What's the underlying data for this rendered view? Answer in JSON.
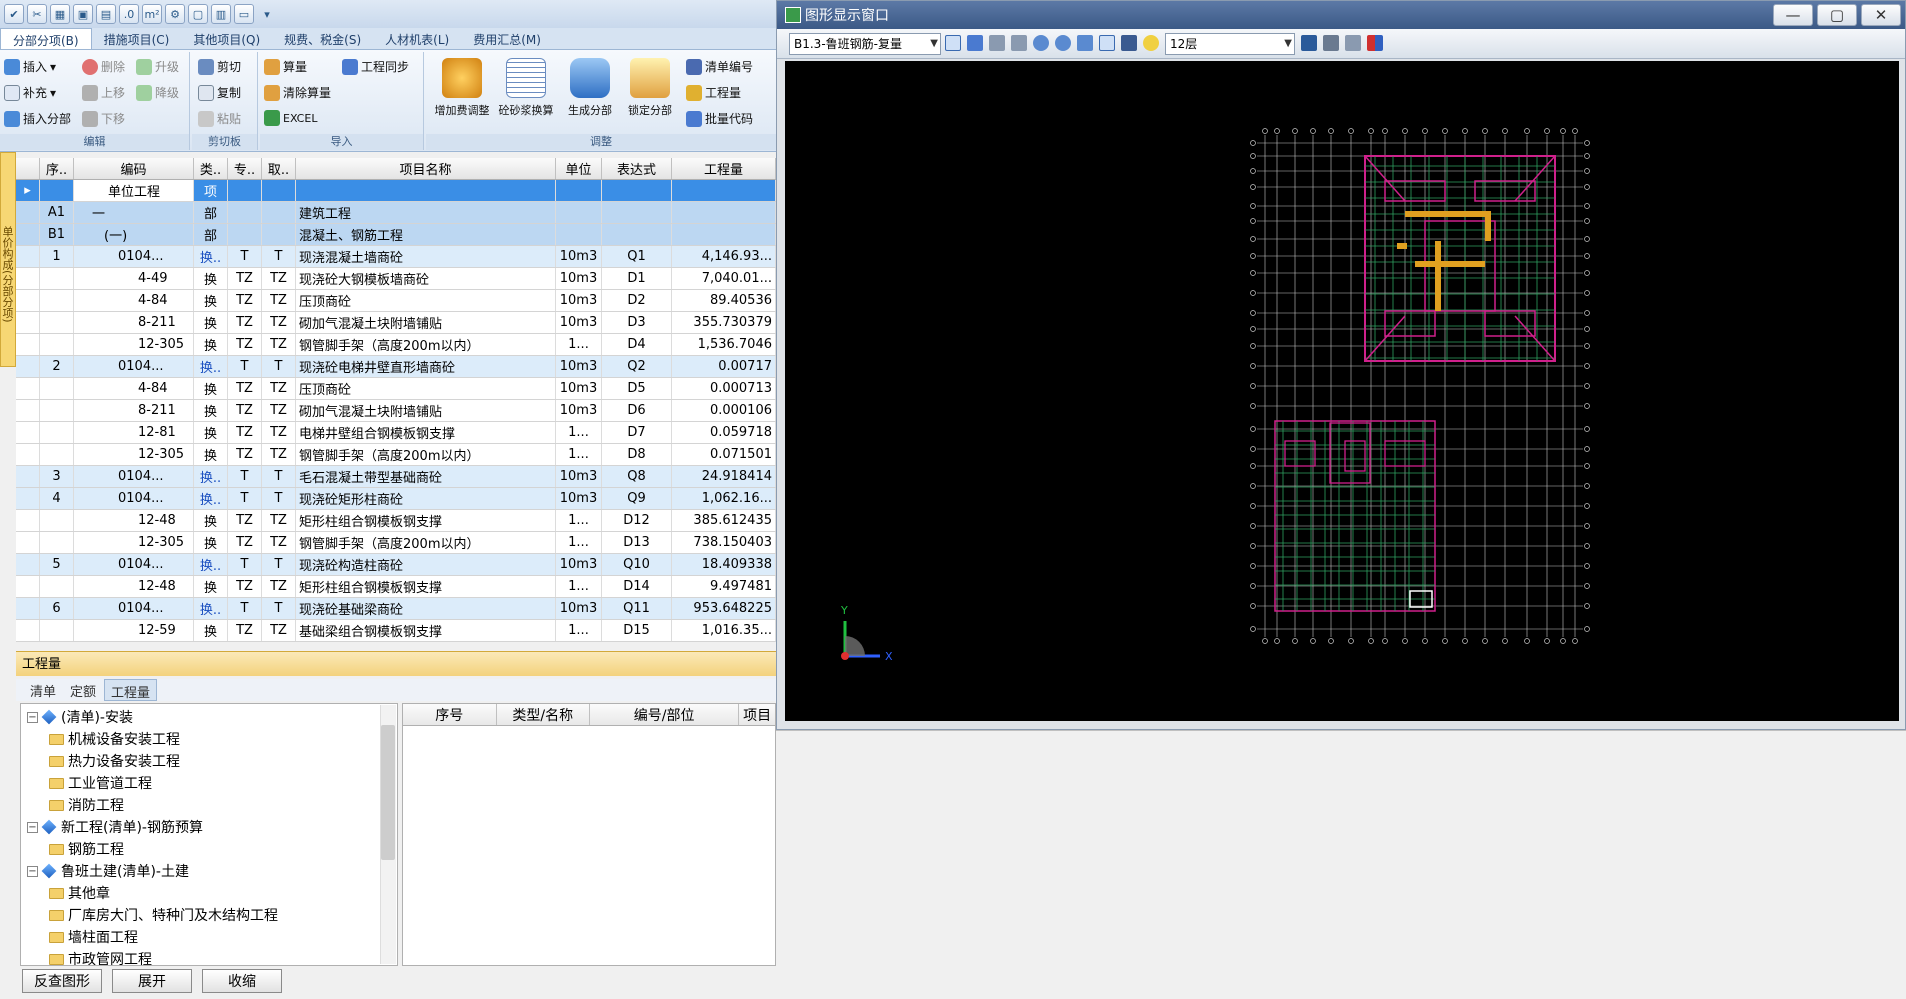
{
  "qat": {
    "icons": [
      "check-icon",
      "tools-icon",
      "calculator-icon",
      "save-icon",
      "chart-icon",
      "decimal-icon",
      "area-icon",
      "settings-icon",
      "document-icon",
      "report-icon",
      "window-icon"
    ]
  },
  "tabs": [
    {
      "label": "分部分项(B)"
    },
    {
      "label": "措施项目(C)"
    },
    {
      "label": "其他项目(Q)"
    },
    {
      "label": "规费、税金(S)"
    },
    {
      "label": "人材机表(L)"
    },
    {
      "label": "费用汇总(M)"
    }
  ],
  "ribbon": {
    "edit": {
      "label": "编辑",
      "insert": "插入",
      "supplement": "补充",
      "insert_part": "插入分部",
      "delete": "删除",
      "upgrade": "升级",
      "move_up": "上移",
      "downgrade": "降级",
      "move_down": "下移"
    },
    "clipboard": {
      "label": "剪切板",
      "cut": "剪切",
      "copy": "复制",
      "paste": "粘贴"
    },
    "import": {
      "label": "导入",
      "calc": "算量",
      "clear_calc": "清除算量",
      "excel": "EXCEL",
      "sync": "工程同步"
    },
    "adjust": {
      "label": "调整",
      "add_fee": "增加费调整",
      "mortar": "砼砂浆换算",
      "gen_part": "生成分部",
      "lock_part": "锁定分部",
      "list_code": "清单编号",
      "quantity": "工程量",
      "batch_code": "批量代码"
    }
  },
  "left_strip": "单价构成(分部分项)",
  "grid": {
    "headers": [
      "序..",
      "编码",
      "类..",
      "专..",
      "取..",
      "项目名称",
      "单位",
      "表达式",
      "工程量"
    ],
    "rows": [
      {
        "seq": "",
        "code": "单位工程",
        "type": "项",
        "spec": "",
        "take": "",
        "name": "",
        "unit": "",
        "expr": "",
        "qty": "",
        "kind": "unit"
      },
      {
        "seq": "A1",
        "code": "一",
        "type": "部",
        "spec": "",
        "take": "",
        "name": "建筑工程",
        "unit": "",
        "expr": "",
        "qty": "",
        "kind": "part"
      },
      {
        "seq": "B1",
        "code": "(一)",
        "type": "部",
        "spec": "",
        "take": "",
        "name": "混凝土、钢筋工程",
        "unit": "",
        "expr": "",
        "qty": "",
        "kind": "part"
      },
      {
        "seq": "1",
        "code": "0104...",
        "type": "换..",
        "spec": "T",
        "take": "T",
        "name": "现浇混凝土墙商砼",
        "unit": "10m3",
        "expr": "Q1",
        "qty": "4,146.93...",
        "kind": "qd"
      },
      {
        "seq": "",
        "code": "4-49",
        "type": "换",
        "spec": "TZ",
        "take": "TZ",
        "name": "现浇砼大钢模板墙商砼",
        "unit": "10m3",
        "expr": "D1",
        "qty": "7,040.01...",
        "kind": "de"
      },
      {
        "seq": "",
        "code": "4-84",
        "type": "换",
        "spec": "TZ",
        "take": "TZ",
        "name": "压顶商砼",
        "unit": "10m3",
        "expr": "D2",
        "qty": "89.40536",
        "kind": "de"
      },
      {
        "seq": "",
        "code": "8-211",
        "type": "换",
        "spec": "TZ",
        "take": "TZ",
        "name": "砌加气混凝土块附墙铺贴",
        "unit": "10m3",
        "expr": "D3",
        "qty": "355.730379",
        "kind": "de"
      },
      {
        "seq": "",
        "code": "12-305",
        "type": "换",
        "spec": "TZ",
        "take": "TZ",
        "name": "钢管脚手架（高度200m以内）",
        "unit": "1...",
        "expr": "D4",
        "qty": "1,536.7046",
        "kind": "de"
      },
      {
        "seq": "2",
        "code": "0104...",
        "type": "换..",
        "spec": "T",
        "take": "T",
        "name": "现浇砼电梯井壁直形墙商砼",
        "unit": "10m3",
        "expr": "Q2",
        "qty": "0.00717",
        "kind": "qd"
      },
      {
        "seq": "",
        "code": "4-84",
        "type": "换",
        "spec": "TZ",
        "take": "TZ",
        "name": "压顶商砼",
        "unit": "10m3",
        "expr": "D5",
        "qty": "0.000713",
        "kind": "de"
      },
      {
        "seq": "",
        "code": "8-211",
        "type": "换",
        "spec": "TZ",
        "take": "TZ",
        "name": "砌加气混凝土块附墙铺贴",
        "unit": "10m3",
        "expr": "D6",
        "qty": "0.000106",
        "kind": "de"
      },
      {
        "seq": "",
        "code": "12-81",
        "type": "换",
        "spec": "TZ",
        "take": "TZ",
        "name": "电梯井壁组合钢模板钢支撑",
        "unit": "1...",
        "expr": "D7",
        "qty": "0.059718",
        "kind": "de"
      },
      {
        "seq": "",
        "code": "12-305",
        "type": "换",
        "spec": "TZ",
        "take": "TZ",
        "name": "钢管脚手架（高度200m以内）",
        "unit": "1...",
        "expr": "D8",
        "qty": "0.071501",
        "kind": "de"
      },
      {
        "seq": "3",
        "code": "0104...",
        "type": "换..",
        "spec": "T",
        "take": "T",
        "name": "毛石混凝土带型基础商砼",
        "unit": "10m3",
        "expr": "Q8",
        "qty": "24.918414",
        "kind": "qd"
      },
      {
        "seq": "4",
        "code": "0104...",
        "type": "换..",
        "spec": "T",
        "take": "T",
        "name": "现浇砼矩形柱商砼",
        "unit": "10m3",
        "expr": "Q9",
        "qty": "1,062.16...",
        "kind": "qd"
      },
      {
        "seq": "",
        "code": "12-48",
        "type": "换",
        "spec": "TZ",
        "take": "TZ",
        "name": "矩形柱组合钢模板钢支撑",
        "unit": "1...",
        "expr": "D12",
        "qty": "385.612435",
        "kind": "de"
      },
      {
        "seq": "",
        "code": "12-305",
        "type": "换",
        "spec": "TZ",
        "take": "TZ",
        "name": "钢管脚手架（高度200m以内）",
        "unit": "1...",
        "expr": "D13",
        "qty": "738.150403",
        "kind": "de"
      },
      {
        "seq": "5",
        "code": "0104...",
        "type": "换..",
        "spec": "T",
        "take": "T",
        "name": "现浇砼构造柱商砼",
        "unit": "10m3",
        "expr": "Q10",
        "qty": "18.409338",
        "kind": "qd"
      },
      {
        "seq": "",
        "code": "12-48",
        "type": "换",
        "spec": "TZ",
        "take": "TZ",
        "name": "矩形柱组合钢模板钢支撑",
        "unit": "1...",
        "expr": "D14",
        "qty": "9.497481",
        "kind": "de"
      },
      {
        "seq": "6",
        "code": "0104...",
        "type": "换..",
        "spec": "T",
        "take": "T",
        "name": "现浇砼基础梁商砼",
        "unit": "10m3",
        "expr": "Q11",
        "qty": "953.648225",
        "kind": "qd"
      },
      {
        "seq": "",
        "code": "12-59",
        "type": "换",
        "spec": "TZ",
        "take": "TZ",
        "name": "基础梁组合钢模板钢支撑",
        "unit": "1...",
        "expr": "D15",
        "qty": "1,016.35...",
        "kind": "de"
      }
    ]
  },
  "quantity_panel": {
    "title": "工程量",
    "tabs": [
      "清单",
      "定额",
      "工程量"
    ],
    "tree": [
      {
        "label": "(清单)-安装",
        "level": 0,
        "kind": "project"
      },
      {
        "label": "机械设备安装工程",
        "level": 1,
        "kind": "folder"
      },
      {
        "label": "热力设备安装工程",
        "level": 1,
        "kind": "folder"
      },
      {
        "label": "工业管道工程",
        "level": 1,
        "kind": "folder"
      },
      {
        "label": "消防工程",
        "level": 1,
        "kind": "folder"
      },
      {
        "label": "新工程(清单)-钢筋预算",
        "level": 0,
        "kind": "project"
      },
      {
        "label": "钢筋工程",
        "level": 1,
        "kind": "folder"
      },
      {
        "label": "鲁班土建(清单)-土建",
        "level": 0,
        "kind": "project"
      },
      {
        "label": "其他章",
        "level": 1,
        "kind": "folder"
      },
      {
        "label": "厂库房大门、特种门及木结构工程",
        "level": 1,
        "kind": "folder"
      },
      {
        "label": "墙柱面工程",
        "level": 1,
        "kind": "folder"
      },
      {
        "label": "市政管网工程",
        "level": 1,
        "kind": "folder"
      }
    ],
    "detail_headers": [
      "序号",
      "类型/名称",
      "编号/部位",
      "项目"
    ],
    "buttons": {
      "review": "反查图形",
      "expand": "展开",
      "collapse": "收缩"
    }
  },
  "graphic_window": {
    "title": "图形显示窗口",
    "project_combo": "B1.3-鲁班钢筋-复量",
    "floor_combo": "12层",
    "axis_x": "X",
    "axis_y": "Y",
    "colors": {
      "canvas": "#000000",
      "grid": "#c8c8c8",
      "wall": "#d0208c",
      "rebar": "#2fa060",
      "column": "#e0a020",
      "axis_x": "#3060ff",
      "axis_y": "#20c040"
    }
  }
}
